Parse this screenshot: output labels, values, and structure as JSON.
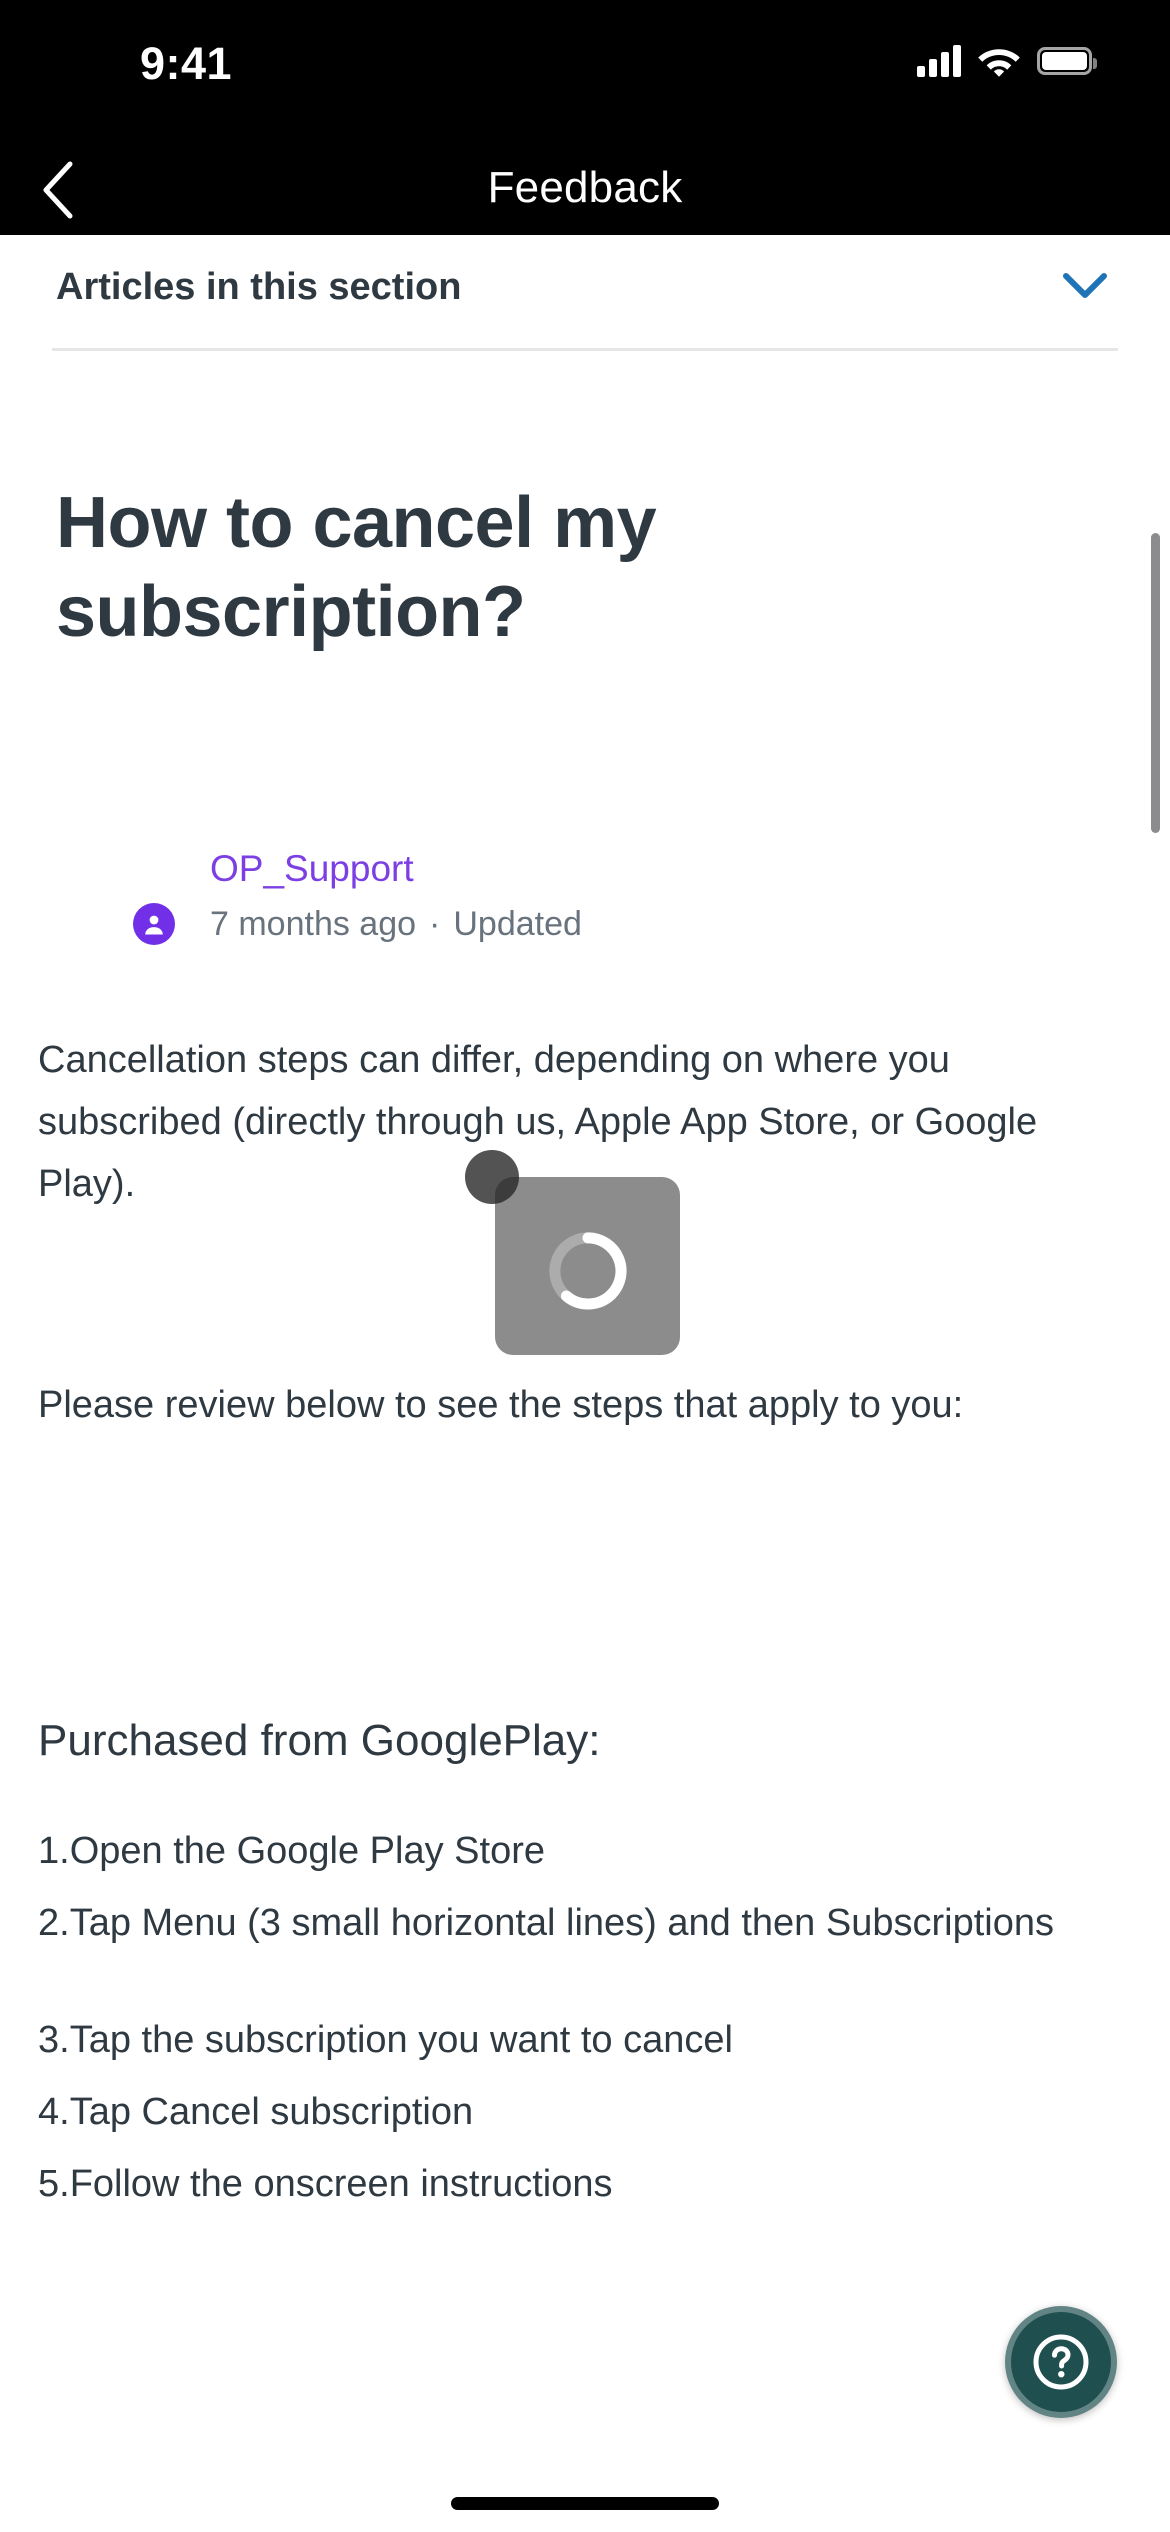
{
  "status_bar": {
    "time": "9:41",
    "signal_icon": "cellular-signal-icon",
    "wifi_icon": "wifi-icon",
    "battery_icon": "battery-icon"
  },
  "nav": {
    "back_icon": "back-chevron-icon",
    "title": "Feedback"
  },
  "articles_section": {
    "label": "Articles in this section",
    "chevron_icon": "chevron-down-icon",
    "chevron_color": "#1F73B7"
  },
  "article": {
    "title": "How to cancel my subscription?",
    "author": "OP_Support",
    "author_color": "#7B3FE4",
    "avatar_icon": "user-avatar-icon",
    "avatar_color": "#7130E8",
    "timestamp": "7 months ago",
    "separator": "·",
    "status": "Updated",
    "paragraphs": [
      "Cancellation steps can differ, depending on where you subscribed (directly through us, Apple App Store, or Google Play).",
      "Please review below to see the steps that apply to you:"
    ],
    "section_heading": "Purchased from GooglePlay:",
    "steps": [
      "1.Open the Google Play Store",
      "2.Tap Menu (3 small horizontal lines) and then Subscriptions",
      "3.Tap the subscription you want to cancel",
      "4.Tap Cancel subscription",
      "5.Follow the onscreen instructions"
    ],
    "text_color": "#2F3941"
  },
  "overlay": {
    "loading_toast_icon": "loading-spinner-icon",
    "touch_indicator_icon": "touch-point-icon"
  },
  "help_button": {
    "icon": "question-mark-circle-icon",
    "color": "#1F504F"
  },
  "scrollbar": {
    "name": "vertical-scrollbar"
  },
  "home_indicator": {
    "name": "home-indicator"
  }
}
